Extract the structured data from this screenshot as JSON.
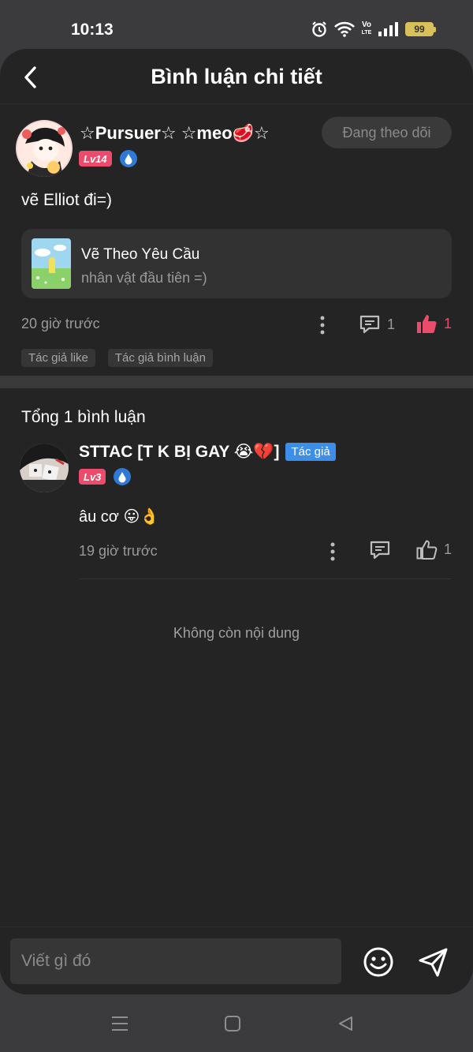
{
  "status_bar": {
    "time": "10:13",
    "battery": "99",
    "volte_top": "Vo",
    "volte_bottom": "LTE",
    "icons": [
      "alarm-icon",
      "wifi-icon",
      "volte-icon",
      "signal-icon",
      "battery-icon"
    ]
  },
  "header": {
    "title": "Bình luận chi tiết",
    "back_icon": "back-arrow-icon"
  },
  "post": {
    "author": "☆Pursuer☆ ☆meo🥩☆",
    "level": "Lv14",
    "follow_label": "Đang theo dõi",
    "text": "vẽ Elliot đi=)",
    "card": {
      "title": "Vẽ Theo Yêu Cầu",
      "subtitle": "nhân vật đầu tiên =)"
    },
    "time": "20 giờ trước",
    "comment_count": "1",
    "like_count": "1",
    "tags": [
      "Tác giả like",
      "Tác giả bình luận"
    ]
  },
  "comments": {
    "total_label": "Tổng 1 bình luận",
    "items": [
      {
        "author": "STTAC [T K BỊ GAY 😭💔]",
        "author_badge": "Tác giả",
        "level": "Lv3",
        "text": "âu cơ 😛👌",
        "time": "19 giờ trước",
        "like_count": "1"
      }
    ],
    "end_label": "Không còn nội dung"
  },
  "input": {
    "placeholder": "Viết gì đó"
  },
  "colors": {
    "background": "#242424",
    "accent_pink": "#ec4b6b",
    "author_blue": "#3d8ee8",
    "muted_text": "#9a9a9a"
  }
}
